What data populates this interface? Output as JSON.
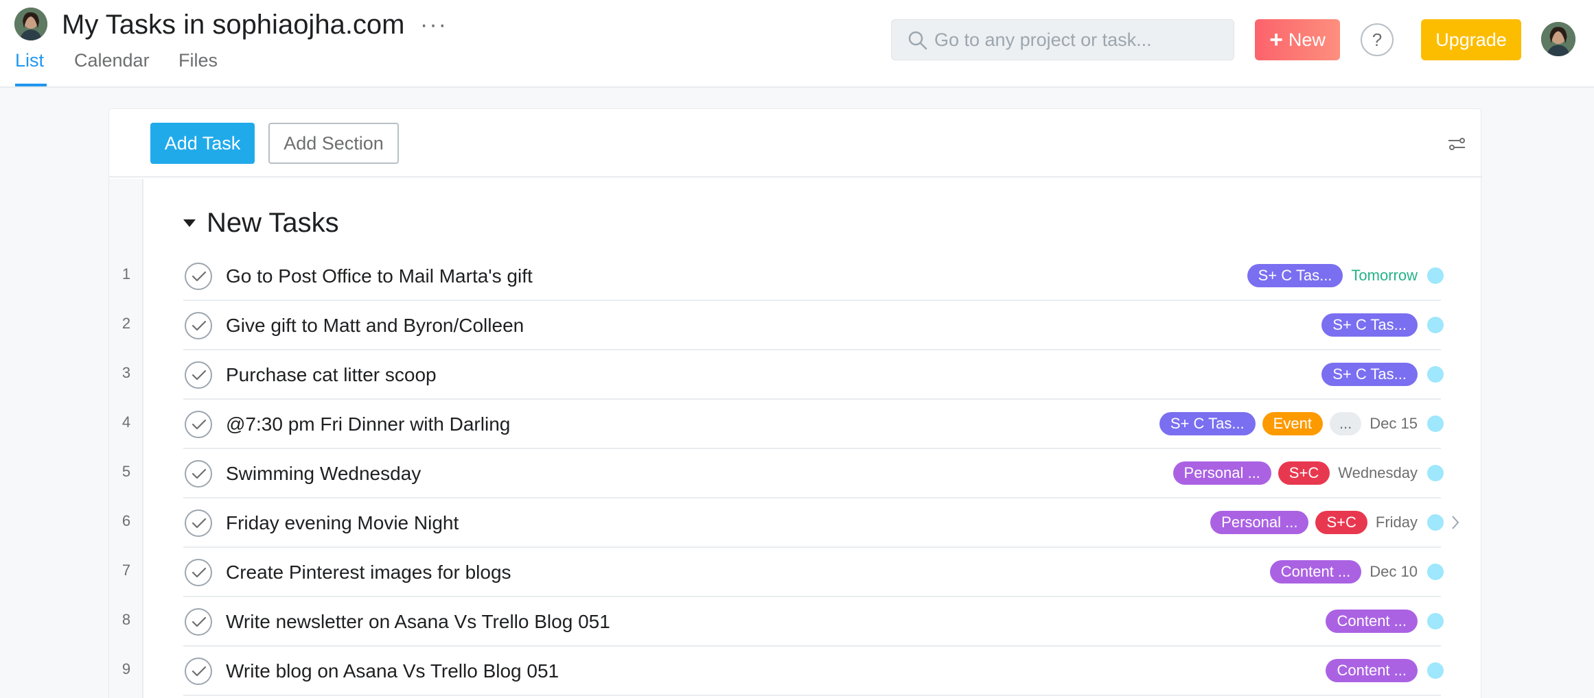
{
  "header": {
    "title": "My Tasks in sophiaojha.com",
    "more_label": "···",
    "tabs": [
      {
        "label": "List",
        "active": true
      },
      {
        "label": "Calendar",
        "active": false
      },
      {
        "label": "Files",
        "active": false
      }
    ]
  },
  "topbar": {
    "search_placeholder": "Go to any project or task...",
    "new_label": "New",
    "help_label": "?",
    "upgrade_label": "Upgrade"
  },
  "toolbar": {
    "add_task_label": "Add Task",
    "add_section_label": "Add Section"
  },
  "section": {
    "title": "New Tasks"
  },
  "tasks": [
    {
      "num": "1",
      "name": "Go to Post Office to Mail Marta's gift",
      "tags": [
        {
          "label": "S+ C Tas...",
          "color": "#7a6ff0"
        }
      ],
      "due": "Tomorrow",
      "due_color": "#25b388"
    },
    {
      "num": "2",
      "name": "Give gift to Matt and Byron/Colleen",
      "tags": [
        {
          "label": "S+ C Tas...",
          "color": "#7a6ff0"
        }
      ],
      "due": "",
      "due_color": "#6d6e6f"
    },
    {
      "num": "3",
      "name": "Purchase cat litter scoop",
      "tags": [
        {
          "label": "S+ C Tas...",
          "color": "#7a6ff0"
        }
      ],
      "due": "",
      "due_color": "#6d6e6f"
    },
    {
      "num": "4",
      "name": "@7:30 pm Fri Dinner with Darling",
      "tags": [
        {
          "label": "S+ C Tas...",
          "color": "#7a6ff0"
        },
        {
          "label": "Event",
          "color": "#fd9a00"
        },
        {
          "label": "...",
          "color": "#e8ecee"
        }
      ],
      "due": "Dec 15",
      "due_color": "#6d6e6f"
    },
    {
      "num": "5",
      "name": "Swimming Wednesday",
      "tags": [
        {
          "label": "Personal ...",
          "color": "#aa62e3"
        },
        {
          "label": "S+C",
          "color": "#e8384f"
        }
      ],
      "due": "Wednesday",
      "due_color": "#6d6e6f"
    },
    {
      "num": "6",
      "name": "Friday evening Movie Night",
      "tags": [
        {
          "label": "Personal ...",
          "color": "#aa62e3"
        },
        {
          "label": "S+C",
          "color": "#e8384f"
        }
      ],
      "due": "Friday",
      "due_color": "#6d6e6f"
    },
    {
      "num": "7",
      "name": "Create Pinterest images for blogs",
      "tags": [
        {
          "label": "Content ...",
          "color": "#aa62e3"
        }
      ],
      "due": "Dec 10",
      "due_color": "#6d6e6f"
    },
    {
      "num": "8",
      "name": "Write newsletter on Asana Vs Trello Blog 051",
      "tags": [
        {
          "label": "Content ...",
          "color": "#aa62e3"
        }
      ],
      "due": "",
      "due_color": "#6d6e6f"
    },
    {
      "num": "9",
      "name": "Write blog on Asana Vs Trello Blog 051",
      "tags": [
        {
          "label": "Content ...",
          "color": "#aa62e3"
        }
      ],
      "due": "",
      "due_color": "#6d6e6f"
    }
  ],
  "colors": {
    "accent_blue": "#1f96f0",
    "add_task_blue": "#20aaea",
    "upgrade_yellow": "#fcbd01",
    "new_coral": "#fc636b",
    "assignee_dot": "#9ee7fc"
  }
}
